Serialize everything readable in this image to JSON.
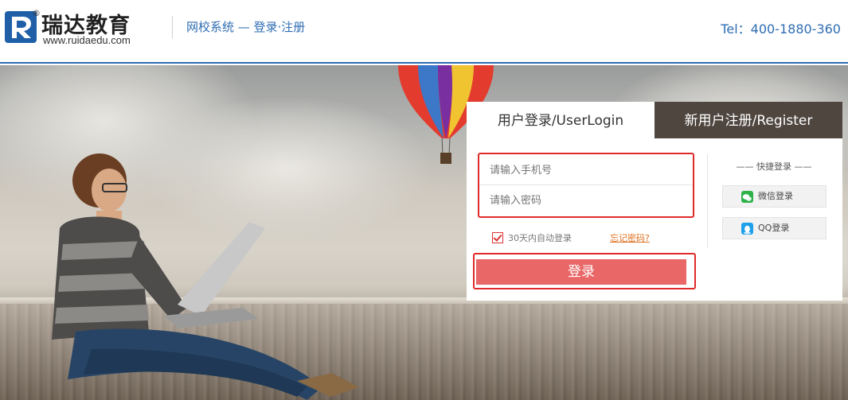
{
  "header": {
    "brand_name": "瑞达教育",
    "brand_url": "www.ruidaedu.com",
    "registered_mark": "®",
    "subtitle": "网校系统 — 登录·注册",
    "tel": "Tel：400-1880-360"
  },
  "login_panel": {
    "tab_login": "用户登录/UserLogin",
    "tab_register": "新用户注册/Register",
    "phone_placeholder": "请输入手机号",
    "password_placeholder": "请输入密码",
    "remember_label": "30天内自动登录",
    "remember_checked": true,
    "forgot_link": "忘记密码?",
    "login_button": "登录",
    "quick_login_title": "—— 快捷登录 ——",
    "wechat_login": "微信登录",
    "qq_login": "QQ登录"
  },
  "colors": {
    "accent_blue": "#2f6db3",
    "login_button": "#e96767",
    "highlight_red": "#e02a2a",
    "register_tab": "#4f463f"
  },
  "icons": {
    "logo": "ruida-logo-icon",
    "wechat": "wechat-icon",
    "qq": "qq-icon",
    "checkbox": "checkmark-icon"
  }
}
